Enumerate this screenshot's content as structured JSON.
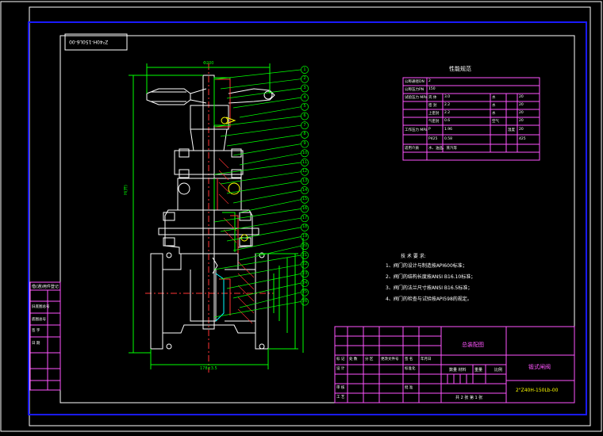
{
  "title_block": {
    "code_mirrored": "Z²40H-150L6-00",
    "code": "2\"Z40H-150Lb-00",
    "drawing_title": "总装配图",
    "part_name": "锻式闸阀",
    "material_hdr": "数量 材料",
    "weight_hdr": "重量",
    "scale_hdr": "比例",
    "sheet": "共 2 张   第 1 张",
    "rev_cols": [
      "标 记",
      "处 数",
      "分 区",
      "更改文件号",
      "签 名",
      "年月日"
    ],
    "rows_left": [
      "设 计",
      "审 核",
      "工 艺"
    ],
    "rows_mid": [
      "标准化",
      "批 准"
    ]
  },
  "left_strip": {
    "header": "借(通)用件登记",
    "rows": [
      "旧底图总号",
      "底图总号",
      "签 字",
      "日 期"
    ]
  },
  "dimensions": {
    "top_width": "Φ200",
    "height": "H(开)",
    "bottom_length": "178±3.5"
  },
  "perf_table": {
    "title": "性能规范",
    "rows": [
      [
        "公称通径DN",
        "2",
        "",
        "",
        "",
        ""
      ],
      [
        "公称压力PN",
        "150",
        "",
        "",
        "",
        ""
      ],
      [
        "试验压力 MPa",
        "壳 体",
        "3.0",
        "水",
        "",
        "20"
      ],
      [
        "",
        "密 封",
        "2.2",
        "水",
        "",
        "20"
      ],
      [
        "",
        "上密封",
        "2.2",
        "水",
        "",
        "20"
      ],
      [
        "",
        "气密封",
        "0.6",
        "空气",
        "",
        "20"
      ],
      [
        "工作压力 MPa",
        "P",
        "1.96",
        "",
        "温度",
        "20"
      ],
      [
        "",
        "P425",
        "0.58",
        "",
        "",
        "425"
      ],
      [
        "适用介质",
        "水、油品、蒸汽等",
        "",
        "",
        "",
        ""
      ]
    ]
  },
  "tech_req": {
    "title": "技 术 要 求:",
    "items": [
      "1、阀门的设计与制造按API600标准；",
      "2、阀门的结构长度按ANSI B16.10标准；",
      "3、阀门的法兰尺寸按ANSI B16.5标准；",
      "4、阀门的检查与试验按API598的规定。"
    ]
  },
  "balloons": [
    "1",
    "2",
    "3",
    "4",
    "5",
    "6",
    "7",
    "8",
    "9",
    "10",
    "11",
    "12",
    "13",
    "14",
    "15",
    "16",
    "17",
    "18",
    "19",
    "20",
    "21",
    "22",
    "23",
    "24",
    "25",
    "26"
  ]
}
